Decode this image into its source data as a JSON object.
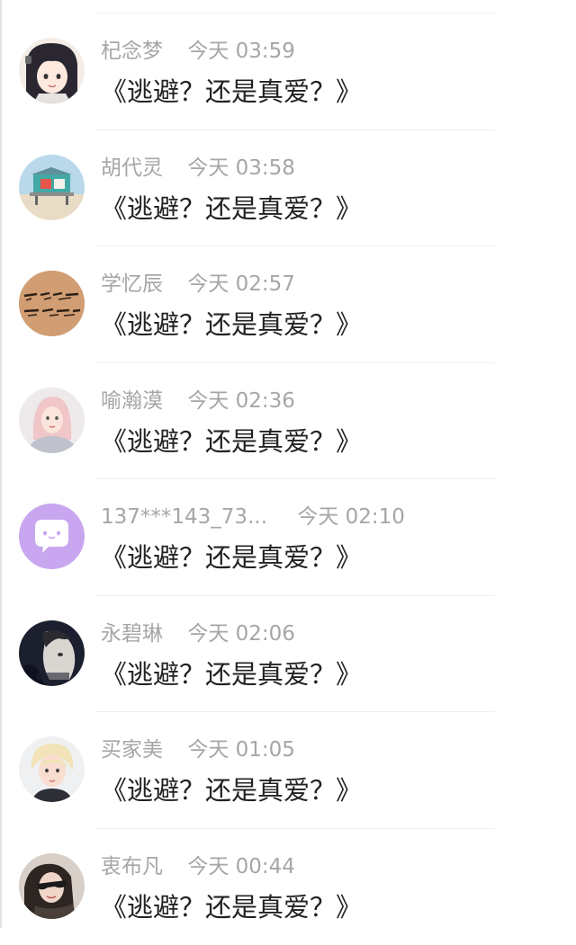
{
  "messages": [
    {
      "name": "杞念梦",
      "time": "今天 03:59",
      "text": "《逃避？还是真爱？》",
      "avatar": "anime-girl-avatar"
    },
    {
      "name": "胡代灵",
      "time": "今天 03:58",
      "text": "《逃避？还是真爱？》",
      "avatar": "beach-hut-avatar"
    },
    {
      "name": "学忆辰",
      "time": "今天 02:57",
      "text": "《逃避？还是真爱？》",
      "avatar": "handwriting-avatar"
    },
    {
      "name": "喻瀚漠",
      "time": "今天 02:36",
      "text": "《逃避？还是真爱？》",
      "avatar": "pink-hair-girl-avatar"
    },
    {
      "name": "137***143_73...",
      "time": "今天 02:10",
      "text": "《逃避？还是真爱？》",
      "avatar": "default-chat-bubble-avatar"
    },
    {
      "name": "永碧琳",
      "time": "今天 02:06",
      "text": "《逃避？还是真爱？》",
      "avatar": "dark-portrait-avatar"
    },
    {
      "name": "买家美",
      "time": "今天 01:05",
      "text": "《逃避？还是真爱？》",
      "avatar": "blonde-boy-avatar"
    },
    {
      "name": "衷布凡",
      "time": "今天 00:44",
      "text": "《逃避？还是真爱？》",
      "avatar": "sunglasses-avatar"
    }
  ],
  "colors": {
    "name_time": "#a6a6a6",
    "message": "#222222",
    "divider": "#efefef",
    "default_avatar_bg": "#c9a6f0"
  }
}
